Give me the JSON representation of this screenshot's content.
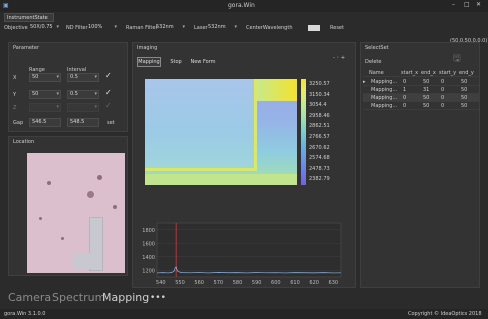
{
  "window": {
    "title": "gora.Win"
  },
  "instrument_tab": "InstrumentState",
  "toolbar": {
    "objective_label": "Objective",
    "objective_value": "50X/0.75",
    "nd_label": "ND Filter",
    "nd_value": "100%",
    "raman_label": "Raman Filter",
    "raman_value": "532nm",
    "laser_label": "Laser",
    "laser_value": "532nm",
    "center_label": "CenterWavelength",
    "reset_label": "Reset"
  },
  "coords": "(50.0,50.0,0.0)",
  "parameter": {
    "title": "Parameter",
    "range_label": "Range",
    "interval_label": "Interval",
    "rows": [
      {
        "axis": "X",
        "range": "50",
        "interval": "0.5"
      },
      {
        "axis": "Y",
        "range": "50",
        "interval": "0.5"
      },
      {
        "axis": "Z",
        "range": "",
        "interval": ""
      }
    ],
    "gap_label": "Gap",
    "gap1": "546.5",
    "gap2": "548.5",
    "set_label": "set"
  },
  "location": {
    "title": "Location"
  },
  "imaging": {
    "title": "Imaging",
    "tabs": [
      "Mapping",
      "Stop",
      "New Form"
    ],
    "zoom_icons": "- ◦ +"
  },
  "colorbar": {
    "labels": [
      "3250.57",
      "3150.34",
      "3054.4",
      "2958.46",
      "2862.51",
      "2766.57",
      "2670.62",
      "2574.68",
      "2478.73",
      "2382.79"
    ],
    "colors": [
      "#f2e22f",
      "#e8ec62",
      "#c9ec8a",
      "#a7e6a4",
      "#86d9bf",
      "#6dc5d8",
      "#62aee3",
      "#6594ea",
      "#6c79ec",
      "#7360e6"
    ]
  },
  "chart_data": {
    "type": "line",
    "x_ticks": [
      "540",
      "550",
      "560",
      "570",
      "580",
      "590",
      "600",
      "610",
      "620",
      "630"
    ],
    "y_ticks": [
      "1800",
      "1600",
      "1400",
      "1200"
    ],
    "ylim": [
      1100,
      1900
    ],
    "xlim": [
      538,
      634
    ],
    "marker_x": 548,
    "series": [
      {
        "values_x": [
          538,
          541,
          544,
          546,
          547,
          547.5,
          548,
          548.5,
          549,
          551,
          555,
          560,
          565,
          570,
          575,
          580,
          585,
          590,
          595,
          600,
          605,
          610,
          615,
          620,
          625,
          630,
          634
        ],
        "values_y": [
          1160,
          1165,
          1160,
          1170,
          1190,
          1240,
          1250,
          1200,
          1180,
          1165,
          1162,
          1166,
          1160,
          1168,
          1163,
          1165,
          1160,
          1166,
          1162,
          1164,
          1160,
          1165,
          1163,
          1161,
          1165,
          1160,
          1162
        ]
      }
    ]
  },
  "selectset": {
    "title": "SelectSet",
    "delete_label": "Delete",
    "columns": [
      "Name",
      "start_x",
      "end_x",
      "start_y",
      "end_y"
    ],
    "rows": [
      {
        "name": "Mapping...",
        "start_x": "0",
        "end_x": "50",
        "start_y": "0",
        "end_y": "50"
      },
      {
        "name": "Mapping...",
        "start_x": "1",
        "end_x": "31",
        "start_y": "0",
        "end_y": "50"
      },
      {
        "name": "Mapping...",
        "start_x": "0",
        "end_x": "50",
        "start_y": "0",
        "end_y": "50"
      },
      {
        "name": "Mapping...",
        "start_x": "0",
        "end_x": "50",
        "start_y": "0",
        "end_y": "50"
      }
    ]
  },
  "bottom_tabs": [
    "Camera",
    "Spectrum",
    "Mapping"
  ],
  "more_label": "•••",
  "status": {
    "version": "gora.Win 3.1.0.0",
    "copyright": "Copyright © IdeaOptics 2018"
  }
}
